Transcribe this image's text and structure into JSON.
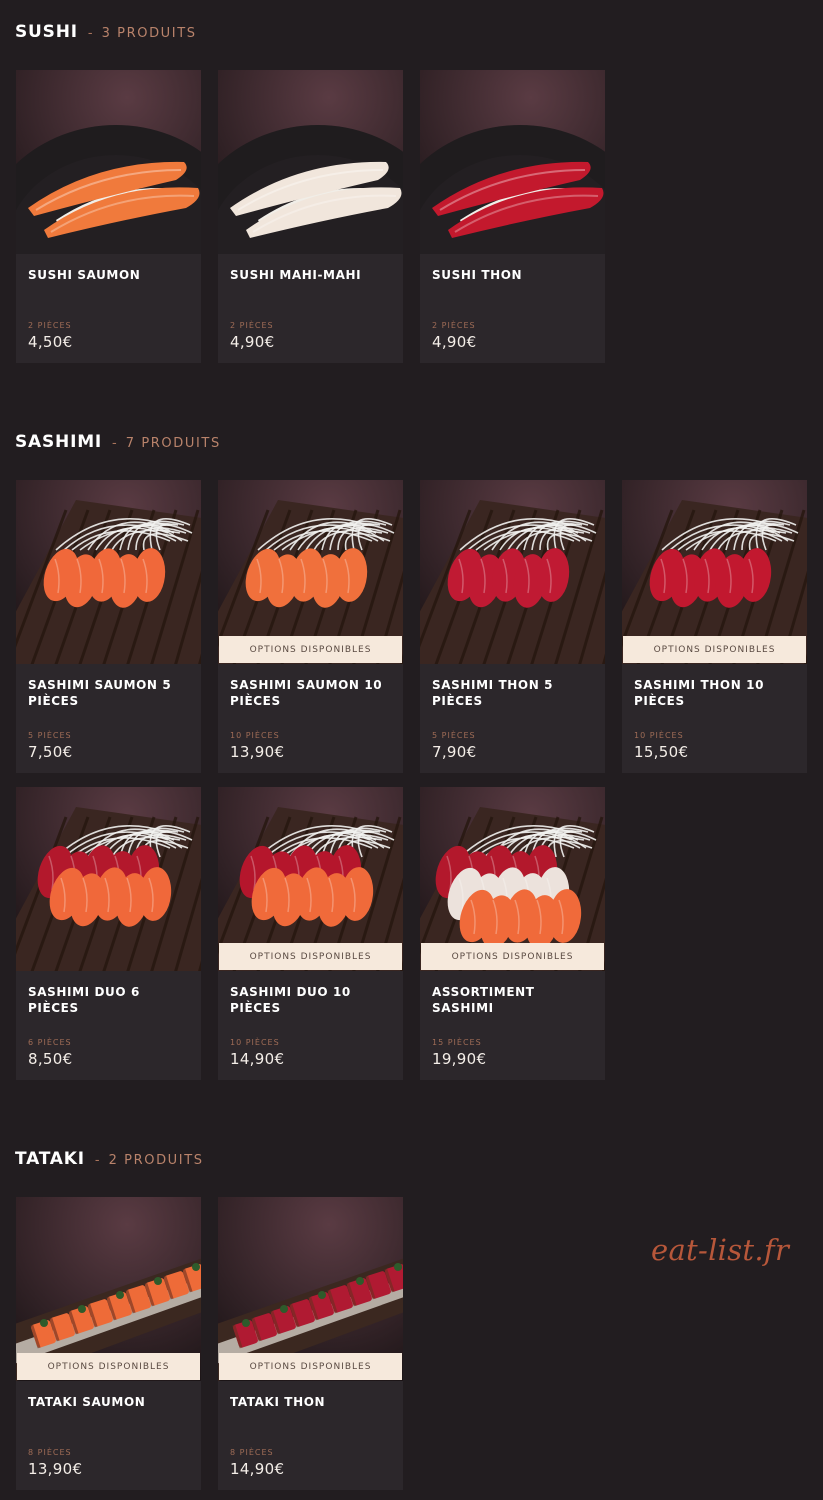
{
  "sections": [
    {
      "title": "SUSHI",
      "separator": "-",
      "count": "3 PRODUITS",
      "items": [
        {
          "name": "SUSHI SAUMON",
          "pieces": "2 PIÈCES",
          "price": "4,50€",
          "badge": "",
          "dish": "sushi",
          "fish_colors": [
            "#f07a3c"
          ]
        },
        {
          "name": "SUSHI MAHI-MAHI",
          "pieces": "2 PIÈCES",
          "price": "4,90€",
          "badge": "",
          "dish": "sushi",
          "fish_colors": [
            "#f1e6dc"
          ]
        },
        {
          "name": "SUSHI THON",
          "pieces": "2 PIÈCES",
          "price": "4,90€",
          "badge": "",
          "dish": "sushi",
          "fish_colors": [
            "#c3192d"
          ]
        }
      ]
    },
    {
      "title": "SASHIMI",
      "separator": "-",
      "count": "7 PRODUITS",
      "items": [
        {
          "name": "SASHIMI SAUMON 5 PIÈCES",
          "pieces": "5 PIÈCES",
          "price": "7,50€",
          "badge": "",
          "dish": "sashimi",
          "fish_colors": [
            "#f0683a"
          ]
        },
        {
          "name": "SASHIMI SAUMON 10 PIÈCES",
          "pieces": "10 PIÈCES",
          "price": "13,90€",
          "badge": "OPTIONS DISPONIBLES",
          "dish": "sashimi",
          "fish_colors": [
            "#f0703c"
          ]
        },
        {
          "name": "SASHIMI THON 5 PIÈCES",
          "pieces": "5 PIÈCES",
          "price": "7,90€",
          "badge": "",
          "dish": "sashimi",
          "fish_colors": [
            "#c01a33"
          ]
        },
        {
          "name": "SASHIMI THON 10 PIÈCES",
          "pieces": "10 PIÈCES",
          "price": "15,50€",
          "badge": "OPTIONS DISPONIBLES",
          "dish": "sashimi",
          "fish_colors": [
            "#c2182f"
          ]
        },
        {
          "name": "SASHIMI DUO 6 PIÈCES",
          "pieces": "6 PIÈCES",
          "price": "8,50€",
          "badge": "",
          "dish": "sashimi",
          "fish_colors": [
            "#b3182c",
            "#f0683a"
          ]
        },
        {
          "name": "SASHIMI DUO 10 PIÈCES",
          "pieces": "10 PIÈCES",
          "price": "14,90€",
          "badge": "OPTIONS DISPONIBLES",
          "dish": "sashimi",
          "fish_colors": [
            "#b5162c",
            "#f06a3a"
          ]
        },
        {
          "name": "ASSORTIMENT SASHIMI",
          "pieces": "15 PIÈCES",
          "price": "19,90€",
          "badge": "OPTIONS DISPONIBLES",
          "dish": "sashimi",
          "fish_colors": [
            "#b3182c",
            "#ece2dc",
            "#f06a3a"
          ]
        }
      ]
    },
    {
      "title": "TATAKI",
      "separator": "-",
      "count": "2 PRODUITS",
      "items": [
        {
          "name": "TATAKI SAUMON",
          "pieces": "8 PIÈCES",
          "price": "13,90€",
          "badge": "OPTIONS DISPONIBLES",
          "dish": "tataki",
          "fish_colors": [
            "#ee6b38"
          ]
        },
        {
          "name": "TATAKI THON",
          "pieces": "8 PIÈCES",
          "price": "14,90€",
          "badge": "OPTIONS DISPONIBLES",
          "dish": "tataki",
          "fish_colors": [
            "#b01a32"
          ]
        }
      ]
    }
  ],
  "watermark": "eat-list.fr"
}
